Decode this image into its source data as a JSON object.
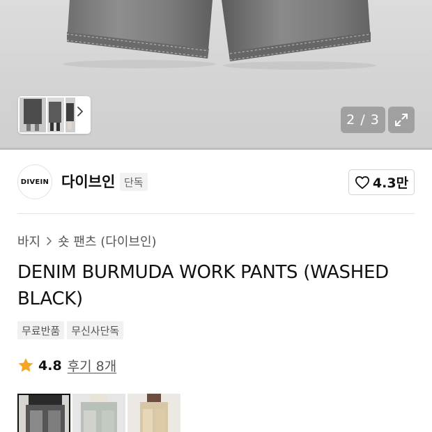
{
  "gallery": {
    "counter": "2 / 3",
    "thumb_next_icon": "chevron-right-icon",
    "expand_icon": "expand-icon"
  },
  "brand": {
    "logo_text": "DIVEIN",
    "name": "다이브인",
    "badge": "단독",
    "like_count": "4.3만",
    "like_icon": "heart-outline-icon"
  },
  "product": {
    "breadcrumb": [
      "바지",
      "숏 팬츠 (다이브인)"
    ],
    "title": "DENIM BURMUDA WORK PANTS (WASHED BLACK)",
    "tags": [
      "무료반품",
      "무신사단독"
    ],
    "rating": "4.8",
    "review_text": "후기 8개",
    "star_color": "#f5a623"
  },
  "variants": [
    {
      "name": "washed-black",
      "selected": true
    },
    {
      "name": "washed-blue",
      "selected": false
    },
    {
      "name": "beige",
      "selected": false
    }
  ]
}
